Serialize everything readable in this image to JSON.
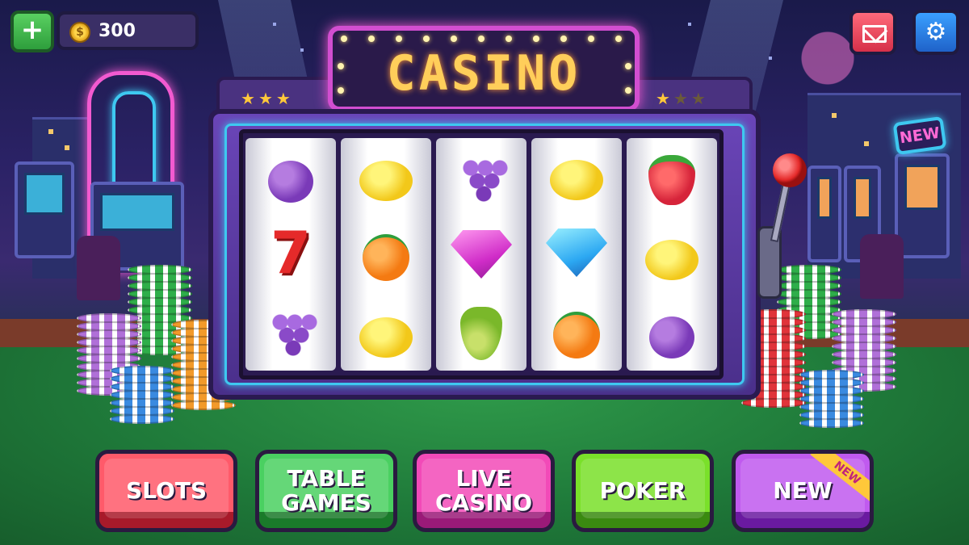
{
  "hud": {
    "coin_balance": "300",
    "add_coins_icon": "plus-icon",
    "coin_icon": "coin-icon",
    "mail_icon": "envelope-icon",
    "settings_icon": "gear-icon"
  },
  "slot_machine": {
    "title": "CASINO",
    "left_stars_lit": 3,
    "right_stars_lit": 1,
    "right_stars_total": 3,
    "reels": [
      [
        "plum",
        "seven",
        "grapes"
      ],
      [
        "lemon",
        "orange",
        "lemon"
      ],
      [
        "grapes",
        "pink-diamond",
        "pear"
      ],
      [
        "lemon",
        "blue-diamond",
        "orange"
      ],
      [
        "strawberry",
        "lemon",
        "plum"
      ]
    ]
  },
  "scene_sign": "NEW",
  "menu": {
    "slots": "SLOTS",
    "table_games": "TABLE\nGAMES",
    "live_casino": "LIVE\nCASINO",
    "poker": "POKER",
    "new": "NEW",
    "new_ribbon": "NEW"
  },
  "colors": {
    "slots": "#ff5a6a",
    "table_games": "#4ad061",
    "live_casino": "#f24ab8",
    "poker": "#7ae02a",
    "new": "#c05aef",
    "marquee_text": "#ffce5a",
    "neon_pink": "#f25ad0",
    "neon_cyan": "#3ec8f0"
  }
}
